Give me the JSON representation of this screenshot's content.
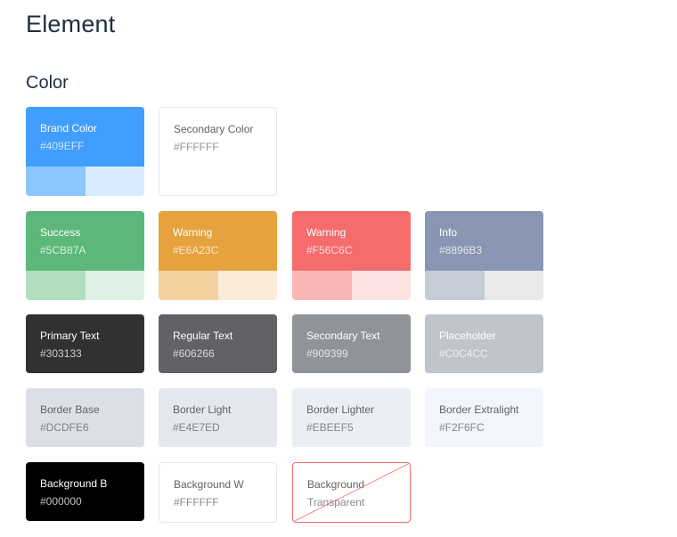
{
  "page": {
    "title": "Element",
    "section": "Color"
  },
  "brand": {
    "primary": {
      "name": "Brand Color",
      "hex": "#409EFF"
    },
    "secondary": {
      "name": "Secondary Color",
      "hex": "#FFFFFF"
    },
    "tints": [
      "#8cc5ff",
      "#d9ecff"
    ]
  },
  "status": [
    {
      "name": "Success",
      "hex": "#5CB87A",
      "tints": [
        "#b3dfc0",
        "#dff1e5"
      ]
    },
    {
      "name": "Warning",
      "hex": "#E6A23C",
      "tints": [
        "#f3d19e",
        "#faecd8"
      ]
    },
    {
      "name": "Warning",
      "hex": "#F56C6C",
      "tints": [
        "#fab6b6",
        "#fde2e2"
      ]
    },
    {
      "name": "Info",
      "hex": "#8896B3",
      "tints": [
        "#c6cbd8",
        "#e9e9eb"
      ]
    }
  ],
  "text": [
    {
      "name": "Primary Text",
      "hex": "#303133"
    },
    {
      "name": "Regular Text",
      "hex": "#606266"
    },
    {
      "name": "Secondary Text",
      "hex": "#909399"
    },
    {
      "name": "Placeholder",
      "hex": "#C0C4CC"
    }
  ],
  "border": [
    {
      "name": "Border Base",
      "hex": "#DCDFE6"
    },
    {
      "name": "Border Light",
      "hex": "#E4E7ED"
    },
    {
      "name": "Border Lighter",
      "hex": "#EBEEF5"
    },
    {
      "name": "Border Extralight",
      "hex": "#F2F6FC"
    }
  ],
  "background": [
    {
      "name": "Background B",
      "hex": "#000000"
    },
    {
      "name": "Background W",
      "hex": "#FFFFFF"
    },
    {
      "name": "Background",
      "hex": "Transparent"
    }
  ]
}
